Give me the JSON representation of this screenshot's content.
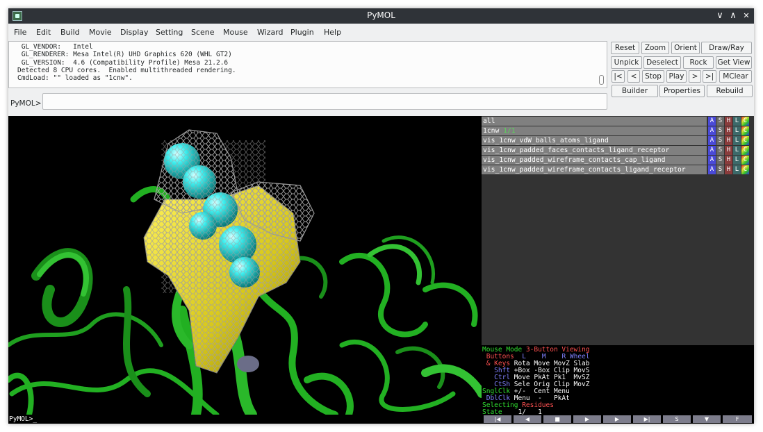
{
  "window": {
    "title": "PyMOL"
  },
  "window_controls": {
    "minimize": "∨",
    "maximize": "∧",
    "close": "✕"
  },
  "menus": [
    "File",
    "Edit",
    "Build",
    "Movie",
    "Display",
    "Setting",
    "Scene",
    "Mouse",
    "Wizard",
    "Plugin",
    "Help"
  ],
  "log": {
    "lines": [
      " GL_VENDOR:   Intel",
      " GL_RENDERER: Mesa Intel(R) UHD Graphics 620 (WHL GT2)",
      " GL_VERSION:  4.6 (Compatibility Profile) Mesa 21.2.6",
      "Detected 8 CPU cores.  Enabled multithreaded rendering.",
      "CmdLoad: \"\" loaded as \"1cnw\"."
    ]
  },
  "command": {
    "label": "PyMOL>",
    "value": ""
  },
  "buttons": {
    "reset": "Reset",
    "zoom": "Zoom",
    "orient": "Orient",
    "draw_ray": "Draw/Ray",
    "unpick": "Unpick",
    "deselect": "Deselect",
    "rock": "Rock",
    "get_view": "Get View",
    "first": "|<",
    "prev": "<",
    "stop": "Stop",
    "play": "Play",
    "next": ">",
    "last": ">|",
    "mclear": "MClear",
    "builder": "Builder",
    "properties": "Properties",
    "rebuild": "Rebuild"
  },
  "objects": [
    {
      "name": "all",
      "extra": ""
    },
    {
      "name": "1cnw",
      "extra": " 1/1"
    },
    {
      "name": "vis_1cnw_vdW_balls_atoms_ligand",
      "extra": ""
    },
    {
      "name": "vis_1cnw_padded_faces_contacts_ligand_receptor",
      "extra": ""
    },
    {
      "name": "vis_1cnw_padded_wireframe_contacts_cap_ligand",
      "extra": ""
    },
    {
      "name": "vis_1cnw_padded_wireframe_contacts_ligand_receptor",
      "extra": ""
    }
  ],
  "object_buttons": {
    "a": "A",
    "s": "S",
    "h": "H",
    "l": "L",
    "c": "C"
  },
  "mouse": {
    "mode_label": "Mouse Mode ",
    "mode_value": "3-Button Viewing",
    "buttons_label": " Buttons",
    "col_l": "L",
    "col_m": "M",
    "col_r": "R",
    "col_wheel": "Wheel",
    "keys_label": " & Keys",
    "keys_row": " Rota Move MovZ Slab",
    "shft_label": "   Shft",
    "shft_row": " +Box -Box Clip MovS",
    "ctrl_label": "   Ctrl",
    "ctrl_row": " Move PkAt Pk1  MvSZ",
    "ctsh_label": "   CtSh",
    "ctsh_row": " Sele Orig Clip MovZ",
    "sngl_label": "SnglClk",
    "sngl_row": " +/-  Cent Menu",
    "dbl_label": " DblClk",
    "dbl_row": " Menu  -   PkAt",
    "selecting_label": "Selecting ",
    "selecting_value": "Residues",
    "state_label": "State",
    "state_value": "    1/   1"
  },
  "state_buttons": [
    "|◀",
    "◀",
    "■",
    "▶",
    "▶",
    "▶|",
    "S",
    "▼",
    "F"
  ],
  "prompt": "PyMOL>_",
  "colors": {
    "protein": "#22b022",
    "ligand": "#2fe6e6",
    "surface": "#d8c81a",
    "mesh": "#9a9a9a",
    "atom_a": "#5ad35a",
    "atom_s": "#4a4ad8"
  }
}
